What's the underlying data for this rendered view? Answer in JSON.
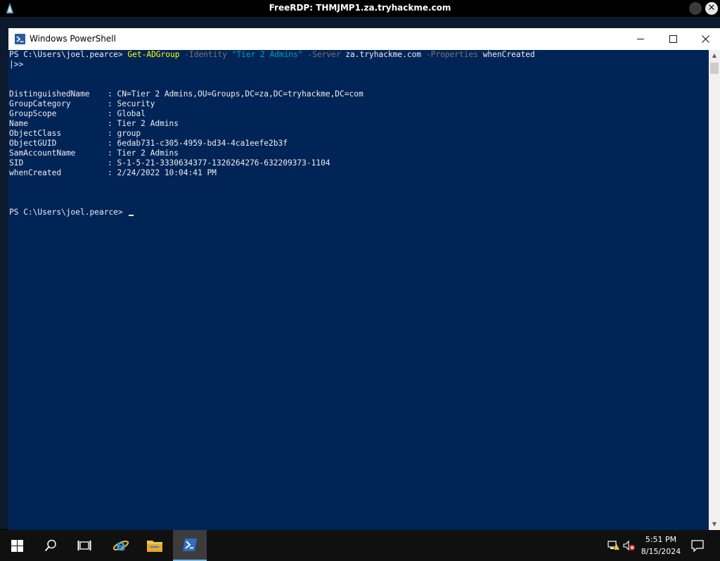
{
  "rdp": {
    "title": "FreeRDP: THMJMP1.za.tryhackme.com",
    "close_glyph": "✕"
  },
  "window": {
    "title": "Windows PowerShell",
    "icon": "powershell-icon"
  },
  "console": {
    "prompt": "PS C:\\Users\\joel.pearce> ",
    "command": {
      "cmdlet": "Get-ADGroup",
      "param_identity": "-Identity",
      "identity_value": "\"Tier 2 Admins\"",
      "param_server": "-Server",
      "server_value": "za.tryhackme.com",
      "param_properties": "-Properties",
      "properties_value": "whenCreated"
    },
    "continuation": "|>>",
    "properties": [
      {
        "name": "DistinguishedName",
        "value": ": CN=Tier 2 Admins,OU=Groups,DC=za,DC=tryhackme,DC=com"
      },
      {
        "name": "GroupCategory",
        "value": ": Security"
      },
      {
        "name": "GroupScope",
        "value": ": Global"
      },
      {
        "name": "Name",
        "value": ": Tier 2 Admins"
      },
      {
        "name": "ObjectClass",
        "value": ": group"
      },
      {
        "name": "ObjectGUID",
        "value": ": 6edab731-c305-4959-bd34-4ca1eefe2b3f"
      },
      {
        "name": "SamAccountName",
        "value": ": Tier 2 Admins"
      },
      {
        "name": "SID",
        "value": ": S-1-5-21-3330634377-1326264276-632209373-1104"
      },
      {
        "name": "whenCreated",
        "value": ": 2/24/2022 10:04:41 PM"
      }
    ],
    "final_prompt": "PS C:\\Users\\joel.pearce> "
  },
  "taskbar": {
    "items": [
      "start-icon",
      "search-icon",
      "task-view-icon",
      "internet-explorer-icon",
      "file-explorer-icon",
      "powershell-icon"
    ],
    "time": "5:51 PM",
    "date": "8/15/2024"
  },
  "colors": {
    "console_bg": "#012456",
    "console_fg": "#eeedf0",
    "cmdlet": "#ffff00",
    "parameter": "#767676",
    "string": "#00a4b7"
  }
}
